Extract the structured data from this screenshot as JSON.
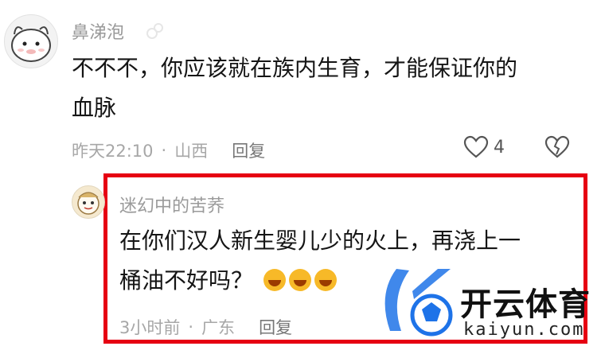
{
  "comment1": {
    "username": "鼻涕泡",
    "text_line1": "不不不，你应该就在族内生育，才能保证你的",
    "text_line2": "血脉",
    "time": "昨天22:10",
    "location": "山西",
    "reply_label": "回复",
    "like_count": "4"
  },
  "comment2": {
    "username": "迷幻中的苦荞",
    "text_line1": "在你们汉人新生婴儿少的火上，再浇上一",
    "text_line2": "桶油不好吗？",
    "time": "3小时前",
    "location": "广东",
    "reply_label": "回复"
  },
  "watermark": {
    "brand_cn": "开云体育",
    "brand_url": "kaiyun.com"
  },
  "colors": {
    "highlight": "#e60012",
    "watermark_blue": "#1e73e8"
  }
}
